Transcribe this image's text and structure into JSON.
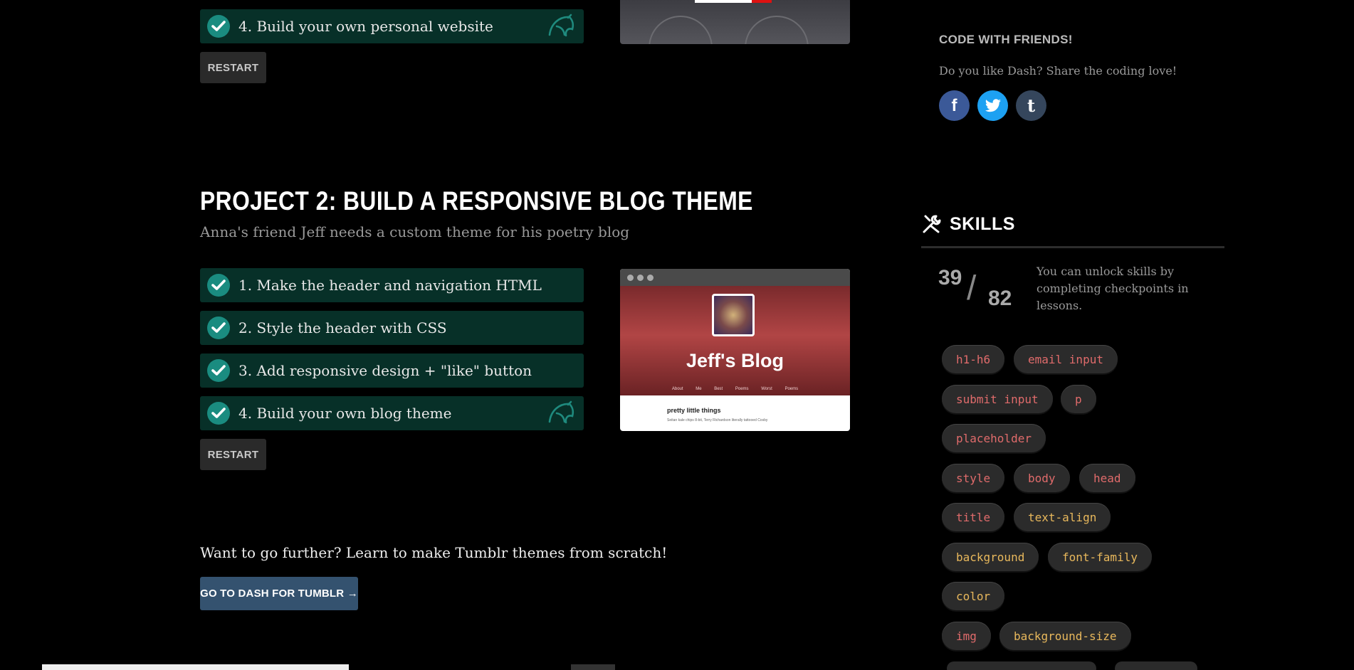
{
  "project1": {
    "last_step": {
      "label": "4. Build your own personal website"
    },
    "restart_label": "RESTART"
  },
  "project2": {
    "title": "PROJECT 2: BUILD A RESPONSIVE BLOG THEME",
    "subtitle": "Anna's friend Jeff needs a custom theme for his poetry blog",
    "steps": [
      {
        "label": "1. Make the header and navigation HTML"
      },
      {
        "label": "2. Style the header with CSS"
      },
      {
        "label": "3. Add responsive design + \"like\" button"
      },
      {
        "label": "4. Build your own blog theme"
      }
    ],
    "restart_label": "RESTART",
    "preview": {
      "blog_title": "Jeff's Blog",
      "nav": "About Me  Best Poems  Worst Poems",
      "post_title": "pretty little things",
      "post_body": "Seitan kale chips 8-bit, Terry Richardson literally tattooed Cosby"
    }
  },
  "further": {
    "text": "Want to go further? Learn to make Tumblr themes from scratch!",
    "button_label": "GO TO DASH FOR TUMBLR →"
  },
  "friends": {
    "title": "CODE WITH FRIENDS!",
    "text": "Do you like Dash? Share the coding love!",
    "icons": {
      "facebook": "f",
      "twitter": "twitter-bird",
      "tumblr": "t"
    }
  },
  "skills": {
    "title": "SKILLS",
    "unlocked": "39",
    "slash": "/",
    "total": "82",
    "description": "You can unlock skills by completing checkpoints in lessons.",
    "tags": [
      {
        "label": "h1-h6",
        "kind": "html"
      },
      {
        "label": "email input",
        "kind": "html"
      },
      {
        "label": "submit input",
        "kind": "html"
      },
      {
        "label": "p",
        "kind": "html"
      },
      {
        "label": "placeholder",
        "kind": "html"
      },
      {
        "label": "style",
        "kind": "html"
      },
      {
        "label": "body",
        "kind": "html"
      },
      {
        "label": "head",
        "kind": "html"
      },
      {
        "label": "title",
        "kind": "html"
      },
      {
        "label": "text-align",
        "kind": "css"
      },
      {
        "label": "background",
        "kind": "css"
      },
      {
        "label": "font-family",
        "kind": "css"
      },
      {
        "label": "color",
        "kind": "css"
      },
      {
        "label": "img",
        "kind": "html"
      },
      {
        "label": "background-size",
        "kind": "css"
      }
    ]
  },
  "colors": {
    "step_bg": "#073028",
    "check": "#1a8c80",
    "html_tag": "#e06b6b",
    "css_tag": "#e8b85c",
    "tumblr_button": "#34526f"
  }
}
